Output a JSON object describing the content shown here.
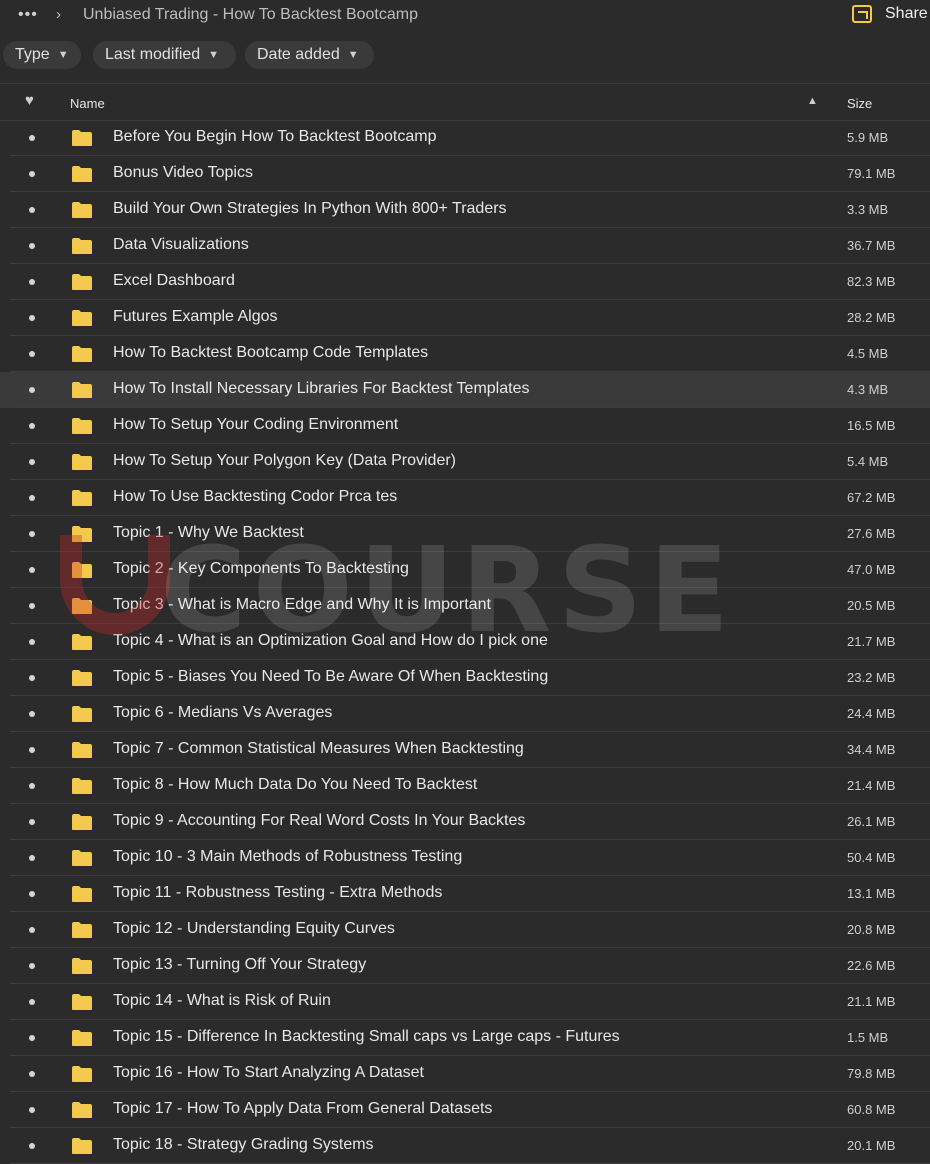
{
  "topbar": {
    "more_label": "•••",
    "chevron": "›",
    "breadcrumb": "Unbiased Trading - How To Backtest Bootcamp",
    "share_label": "Share",
    "share_icon": "share-folder-icon"
  },
  "filters": {
    "type_label": "Type",
    "last_modified_label": "Last modified",
    "date_added_label": "Date added"
  },
  "table": {
    "col_fav_icon": "heart-icon",
    "col_name": "Name",
    "col_size": "Size",
    "sort_direction": "ascending"
  },
  "colors": {
    "background": "#2b2b2b",
    "folder": "#f2c94c",
    "highlight_row": "#3a3a3a"
  },
  "watermark": {
    "text": "COURSE"
  },
  "files": [
    {
      "name": "Before You Begin How To Backtest Bootcamp",
      "size": "5.9 MB"
    },
    {
      "name": "Bonus Video Topics",
      "size": "79.1 MB"
    },
    {
      "name": "Build Your Own Strategies In Python With 800+ Traders",
      "size": "3.3 MB"
    },
    {
      "name": "Data Visualizations",
      "size": "36.7 MB"
    },
    {
      "name": "Excel Dashboard",
      "size": "82.3 MB"
    },
    {
      "name": "Futures Example Algos",
      "size": "28.2 MB"
    },
    {
      "name": "How To Backtest Bootcamp Code Templates",
      "size": "4.5 MB"
    },
    {
      "name": "How To Install Necessary Libraries For Backtest Templates",
      "size": "4.3 MB"
    },
    {
      "name": "How To Setup Your Coding Environment",
      "size": "16.5 MB"
    },
    {
      "name": "How To Setup Your Polygon Key (Data Provider)",
      "size": "5.4 MB"
    },
    {
      "name": "How To Use Backtesting Codor Prca tes",
      "size": "67.2 MB"
    },
    {
      "name": "Topic 1 - Why We Backtest",
      "size": "27.6 MB"
    },
    {
      "name": "Topic 2 - Key Components To Backtesting",
      "size": "47.0 MB"
    },
    {
      "name": "Topic 3 - What is Macro Edge and Why It is Important",
      "size": "20.5 MB"
    },
    {
      "name": "Topic 4 - What is an Optimization Goal and How do I pick one",
      "size": "21.7 MB"
    },
    {
      "name": "Topic 5 - Biases You Need To Be Aware Of When Backtesting",
      "size": "23.2 MB"
    },
    {
      "name": "Topic 6 - Medians Vs Averages",
      "size": "24.4 MB"
    },
    {
      "name": "Topic 7 - Common Statistical Measures When Backtesting",
      "size": "34.4 MB"
    },
    {
      "name": "Topic 8 - How Much Data Do You Need To Backtest",
      "size": "21.4 MB"
    },
    {
      "name": "Topic 9 - Accounting For Real Word Costs In Your Backtes",
      "size": "26.1 MB"
    },
    {
      "name": "Topic 10 - 3 Main Methods of Robustness Testing",
      "size": "50.4 MB"
    },
    {
      "name": "Topic 11 - Robustness Testing - Extra Methods",
      "size": "13.1 MB"
    },
    {
      "name": "Topic 12 - Understanding Equity Curves",
      "size": "20.8 MB"
    },
    {
      "name": "Topic 13 - Turning Off Your Strategy",
      "size": "22.6 MB"
    },
    {
      "name": "Topic 14 - What is Risk of Ruin",
      "size": "21.1 MB"
    },
    {
      "name": "Topic 15 - Difference In Backtesting Small caps vs Large caps - Futures",
      "size": "1.5 MB"
    },
    {
      "name": "Topic 16 - How To Start Analyzing A Dataset",
      "size": "79.8 MB"
    },
    {
      "name": "Topic 17 - How To Apply Data From General Datasets",
      "size": "60.8 MB"
    },
    {
      "name": "Topic 18 - Strategy Grading Systems",
      "size": "20.1 MB"
    }
  ],
  "highlighted_index": 7
}
